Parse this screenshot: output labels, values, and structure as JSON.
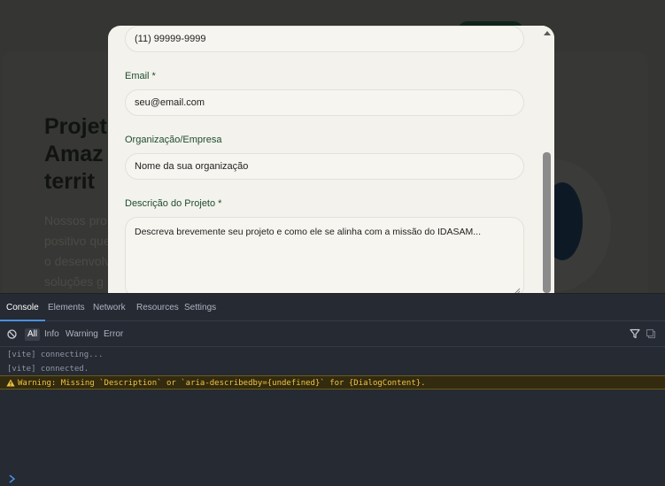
{
  "background_page": {
    "title_lines": [
      "Projet",
      "Amaz",
      "territ"
    ],
    "text_lines": [
      "Nossos pro",
      "positivo que",
      "o desenvolvi",
      "soluções g"
    ]
  },
  "dialog": {
    "phone_value": "(11) 99999-9999",
    "email_label": "Email *",
    "email_placeholder": "seu@email.com",
    "org_label": "Organização/Empresa",
    "org_placeholder": "Nome da sua organização",
    "description_label": "Descrição do Projeto *",
    "description_placeholder": "Descreva brevemente seu projeto e como ele se alinha com a missão do IDASAM..."
  },
  "devtools": {
    "tabs": [
      {
        "label": "Console",
        "active": true
      },
      {
        "label": "Elements",
        "active": false
      },
      {
        "label": "Network",
        "active": false
      },
      {
        "label": "Resources",
        "active": false
      },
      {
        "label": "Settings",
        "active": false
      }
    ],
    "levels": [
      {
        "label": "All",
        "active": true
      },
      {
        "label": "Info",
        "active": false
      },
      {
        "label": "Warning",
        "active": false
      },
      {
        "label": "Error",
        "active": false
      }
    ],
    "logs": [
      {
        "type": "log",
        "text": "[vite] connecting..."
      },
      {
        "type": "log",
        "text": "[vite] connected."
      },
      {
        "type": "warn",
        "text": "Warning: Missing `Description` or `aria-describedby={undefined}` for {DialogContent}."
      }
    ]
  },
  "colors": {
    "accent": "#4a90e2",
    "warning": "#f0c23f",
    "label_green": "#1e4d2e"
  }
}
